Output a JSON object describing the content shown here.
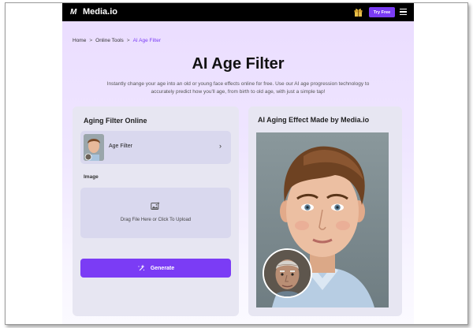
{
  "header": {
    "logo_mark": "M",
    "logo_text": "Media.io",
    "try_button": "Try Free",
    "promo_icon": "gift-icon",
    "menu_icon": "hamburger-icon"
  },
  "breadcrumb": {
    "home": "Home",
    "sep1": ">",
    "tools": "Online Tools",
    "sep2": ">",
    "current": "AI Age Filter"
  },
  "hero": {
    "title": "AI Age Filter",
    "subtitle": "Instantly change your age into an old or young face effects online for free. Use our AI age progression technology to accurately predict how you'll age, from birth to old age, with just a simple tap!"
  },
  "left_card": {
    "heading": "Aging Filter Online",
    "filter_label": "Age Filter",
    "chevron": "›",
    "image_label": "Image",
    "upload_text": "Drag File Here or Click To Upload",
    "generate_label": "Generate"
  },
  "right_card": {
    "heading": "AI Aging Effect Made by Media.io"
  },
  "colors": {
    "accent": "#7b3cf5",
    "topbar": "#000000",
    "card_bg": "#e7e6f2"
  }
}
